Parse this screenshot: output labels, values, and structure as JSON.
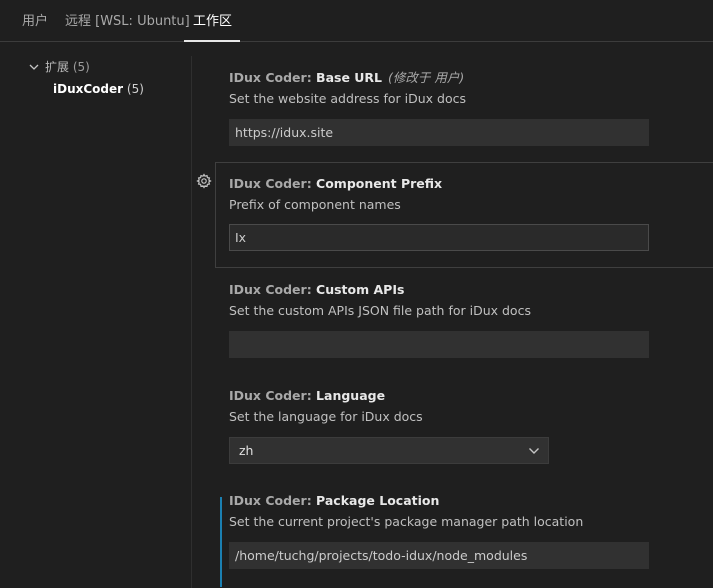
{
  "tabs": [
    {
      "label": "用户"
    },
    {
      "label": "远程 [WSL: Ubuntu]"
    },
    {
      "label": "工作区"
    }
  ],
  "tree": {
    "extensions": {
      "label": "扩展",
      "count": "(5)"
    },
    "idux": {
      "label": "iDuxCoder",
      "count": "(5)"
    }
  },
  "settings": [
    {
      "category": "IDux Coder: ",
      "name": "Base URL",
      "modified_note": "(修改于 用户)",
      "description": "Set the website address for iDux docs",
      "value": "https://idux.site"
    },
    {
      "category": "IDux Coder: ",
      "name": "Component Prefix",
      "description": "Prefix of component names",
      "value": "Ix"
    },
    {
      "category": "IDux Coder: ",
      "name": "Custom APIs",
      "description": "Set the custom APIs JSON file path for iDux docs",
      "value": ""
    },
    {
      "category": "IDux Coder: ",
      "name": "Language",
      "description": "Set the language for iDux docs",
      "value": "zh"
    },
    {
      "category": "IDux Coder: ",
      "name": "Package Location",
      "description": "Set the current project's package manager path location",
      "value": "/home/tuchg/projects/todo-idux/node_modules"
    }
  ],
  "icons": {
    "tree_toggle": "chevron-down-icon",
    "manage": "gear-icon",
    "select_caret": "chevron-down-icon"
  },
  "colors": {
    "background": "#1f1f1f",
    "modified_indicator": "#1b80b2",
    "input_background": "#313131"
  }
}
